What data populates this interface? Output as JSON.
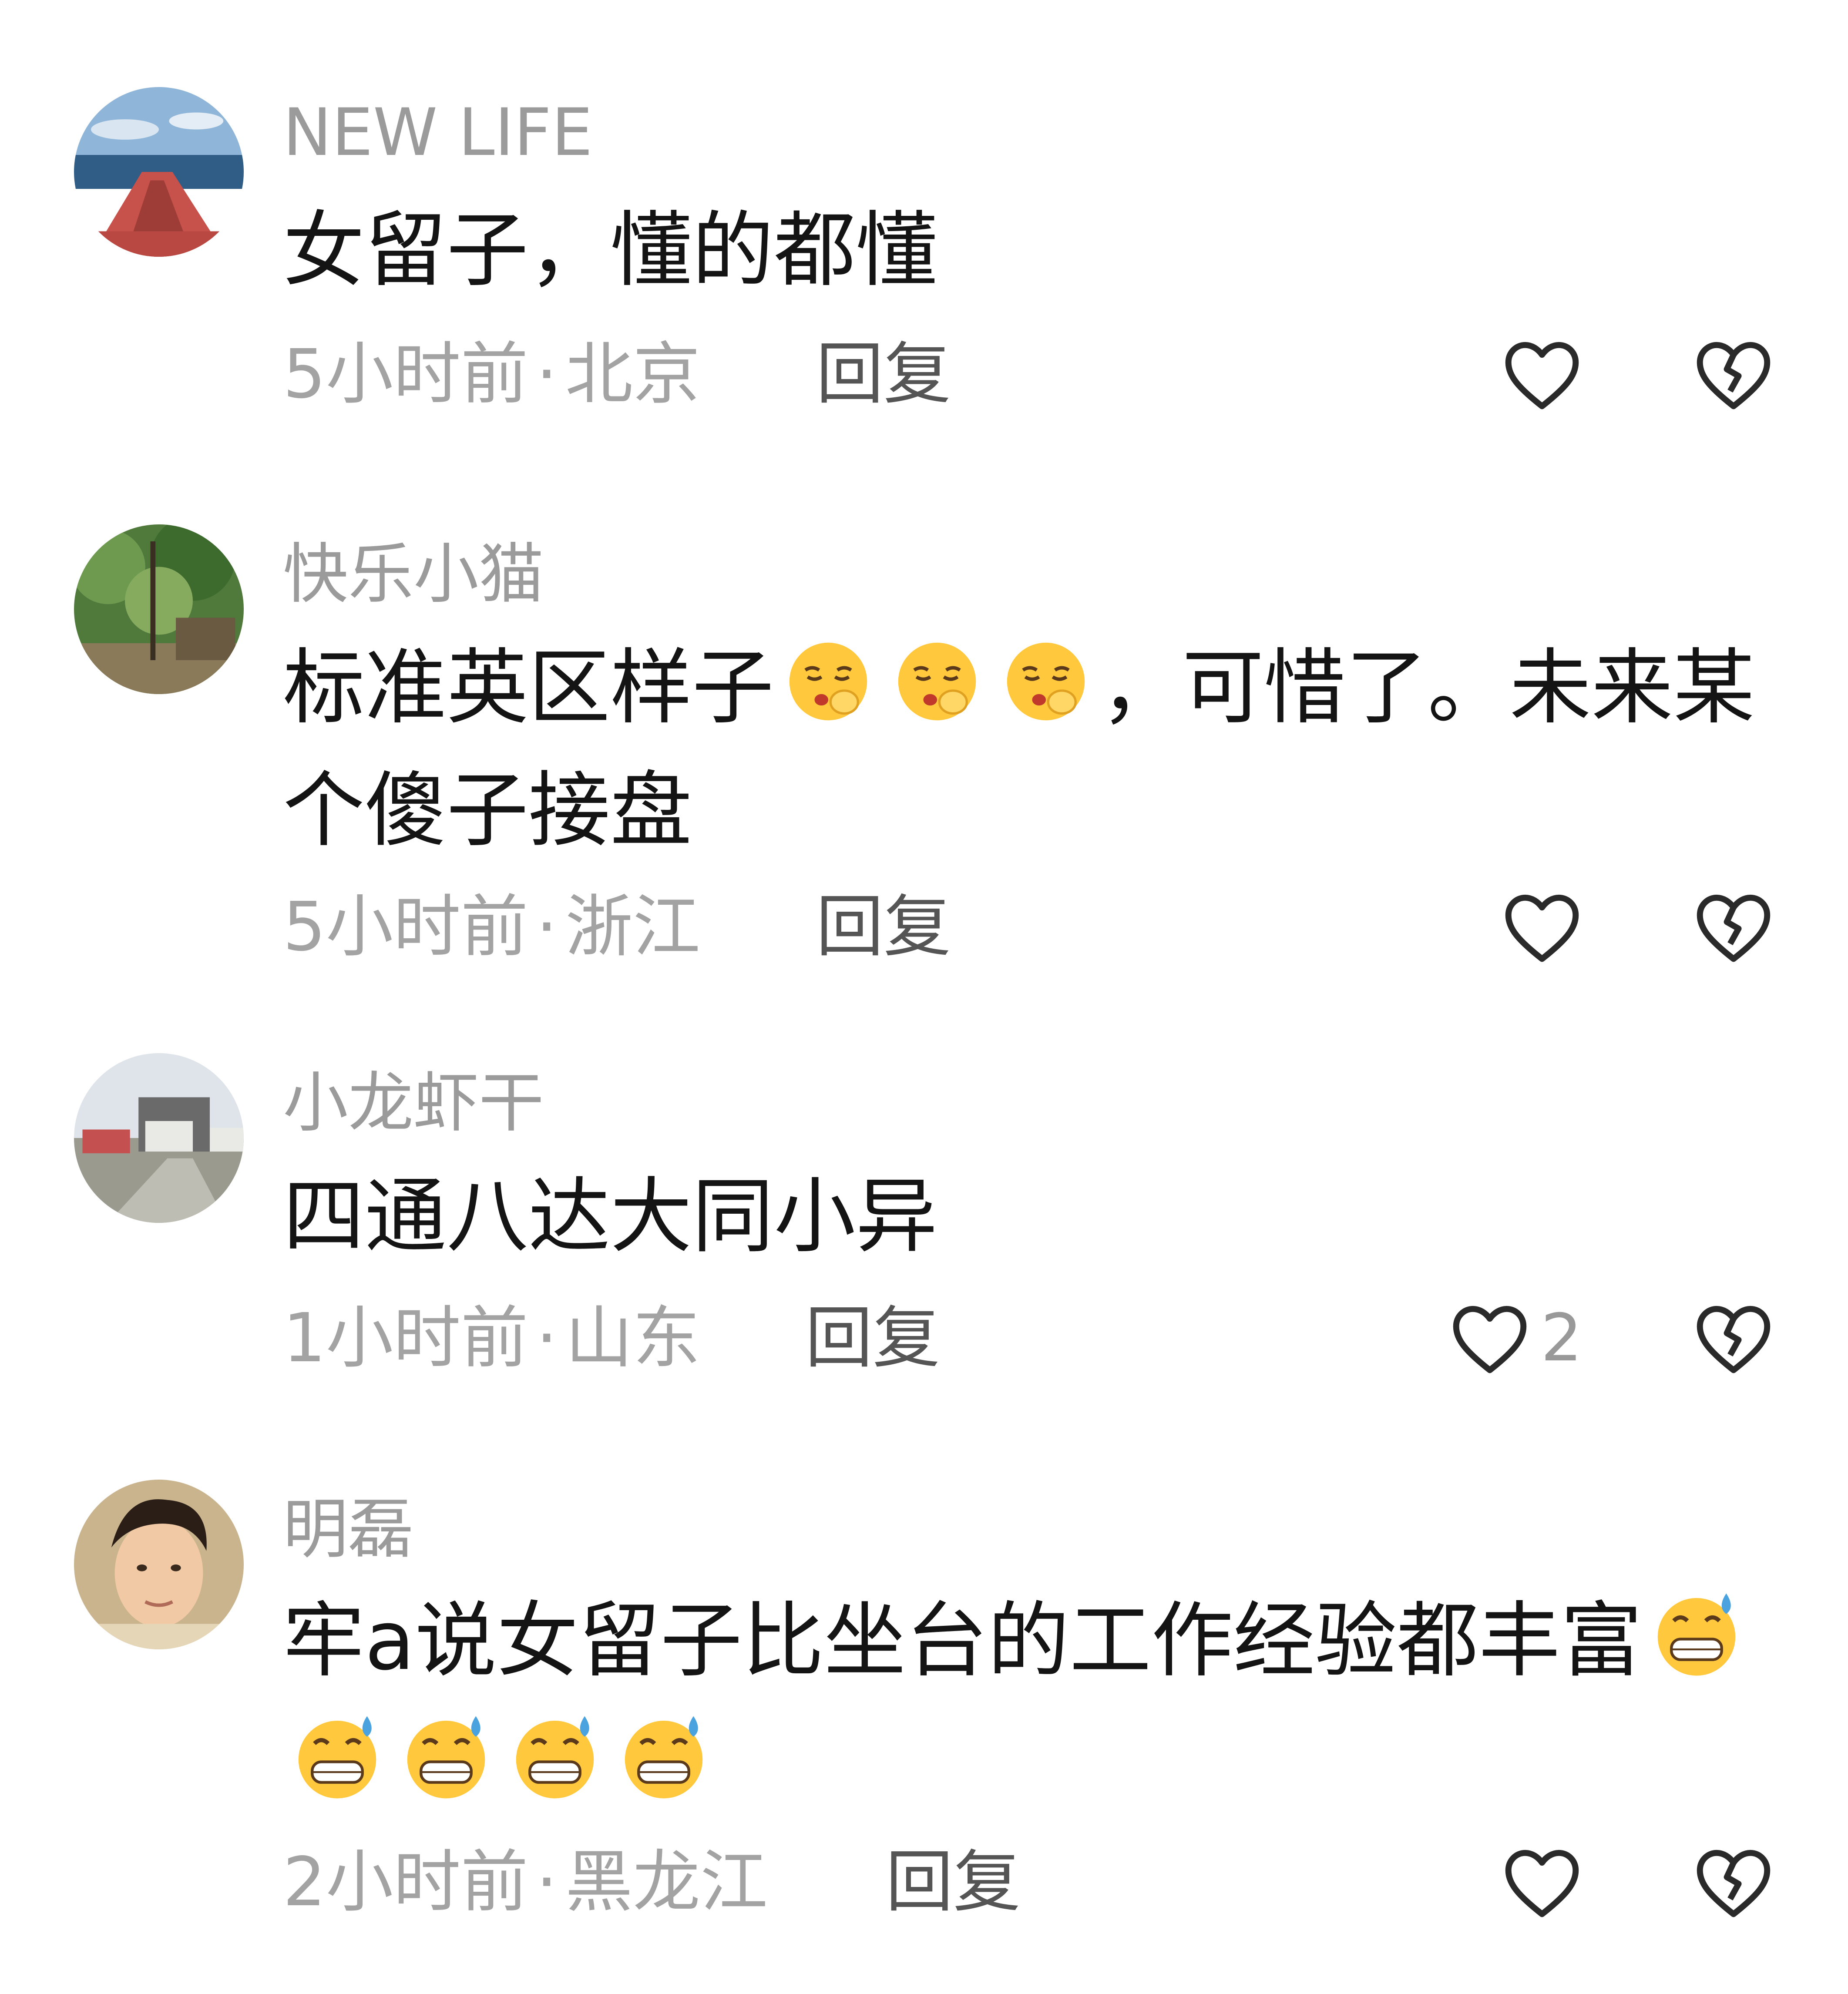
{
  "comments": [
    {
      "username": "NEW LIFE",
      "text": "女留子，懂的都懂",
      "time": "5小时前",
      "location": "北京",
      "reply_label": "回复",
      "like_count": "",
      "avatar": "ship-deck-avatar"
    },
    {
      "username": "快乐小猫",
      "text_before": "标准英区样子",
      "text_after": "，可惜了。未来某个傻子接盘",
      "emoji_count": 3,
      "emoji_name": "shushing-face-emoji",
      "time": "5小时前",
      "location": "浙江",
      "reply_label": "回复",
      "like_count": "",
      "avatar": "forest-avatar"
    },
    {
      "username": "小龙虾干",
      "text": "四通八达大同小异",
      "time": "1小时前",
      "location": "山东",
      "reply_label": "回复",
      "like_count": "2",
      "avatar": "house-avatar"
    },
    {
      "username": "明磊",
      "text_before": "牢a说女留子比坐台的工作经验都丰富",
      "emoji_count": 5,
      "emoji_name": "grimacing-sweat-emoji",
      "time": "2小时前",
      "location": "黑龙江",
      "reply_label": "回复",
      "like_count": "",
      "avatar": "person-avatar"
    }
  ],
  "separator": "·",
  "colors": {
    "username": "#9b9b9b",
    "body": "#141414",
    "meta": "#a3a3a3",
    "reply": "#555555",
    "icon": "#2a2a2a"
  }
}
